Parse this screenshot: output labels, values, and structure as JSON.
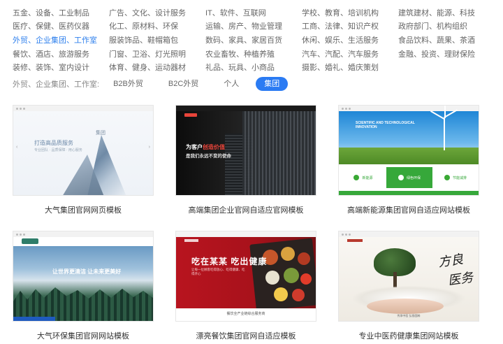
{
  "categories": [
    [
      "五金、设备、工业制品",
      "广告、文化、设计服务",
      "IT、软件、互联网",
      "学校、教育、培训机构",
      "建筑建材、能源、科技"
    ],
    [
      "医疗、保健、医药仪器",
      "化工、原材料、环保",
      "运输、房产、物业管理",
      "工商、法律、知识产权",
      "政府部门、机构组织"
    ],
    [
      "外贸、企业集团、工作室",
      "服装饰品、鞋帽箱包",
      "数码、家具、家居百货",
      "休闲、娱乐、生活服务",
      "食品饮料、蔬果、茶酒"
    ],
    [
      "餐饮、酒店、旅游服务",
      "门窗、卫浴、灯光照明",
      "农业畜牧、种植养殖",
      "汽车、汽配、汽车服务",
      "金融、投资、理财保险"
    ],
    [
      "装修、装饰、室内设计",
      "体育、健身、运动器材",
      "礼品、玩具、小商品",
      "摄影、婚礼、婚庆策划",
      ""
    ]
  ],
  "active_category": "外贸、企业集团、工作室",
  "filter": {
    "label": "外贸、企业集团、工作室:",
    "chips": [
      "B2B外贸",
      "B2C外贸",
      "个人",
      "集团"
    ],
    "active": "集团"
  },
  "templates": [
    {
      "title": "大气集团官网网页模板",
      "preview": {
        "headline": "打造高品质服务",
        "subline": "专业团队 · 品质保障 · 用心服务",
        "tag": "集团"
      }
    },
    {
      "title": "高端集团企业官网自适应官网模板",
      "preview": {
        "headline_a": "为客户",
        "headline_b": "创造价值",
        "subline": "是我们永远不变的使命"
      }
    },
    {
      "title": "高端新能源集团官网自适应网站模板",
      "preview": {
        "headline": "SCIENTIFIC AND TECHNOLOGICAL INNOVATION",
        "tiles": [
          "新能源",
          "绿色环保",
          "节能减排"
        ]
      }
    },
    {
      "title": "大气环保集团官网网站模板",
      "preview": {
        "headline": "让世界更清洁 让未来更美好"
      }
    },
    {
      "title": "漂亮餐饮集团官网自适应模板",
      "preview": {
        "headline": "吃在某某 吃出健康",
        "subline": "让每一位顾客吃得放心、吃得健康、吃得开心",
        "footer": "餐饮全产业链综合服务商"
      }
    },
    {
      "title": "专业中医药健康集团网站模板",
      "preview": {
        "calligraphy_a": "方良",
        "calligraphy_b": "医务",
        "footer": "传承中医 弘扬国粹"
      }
    }
  ]
}
